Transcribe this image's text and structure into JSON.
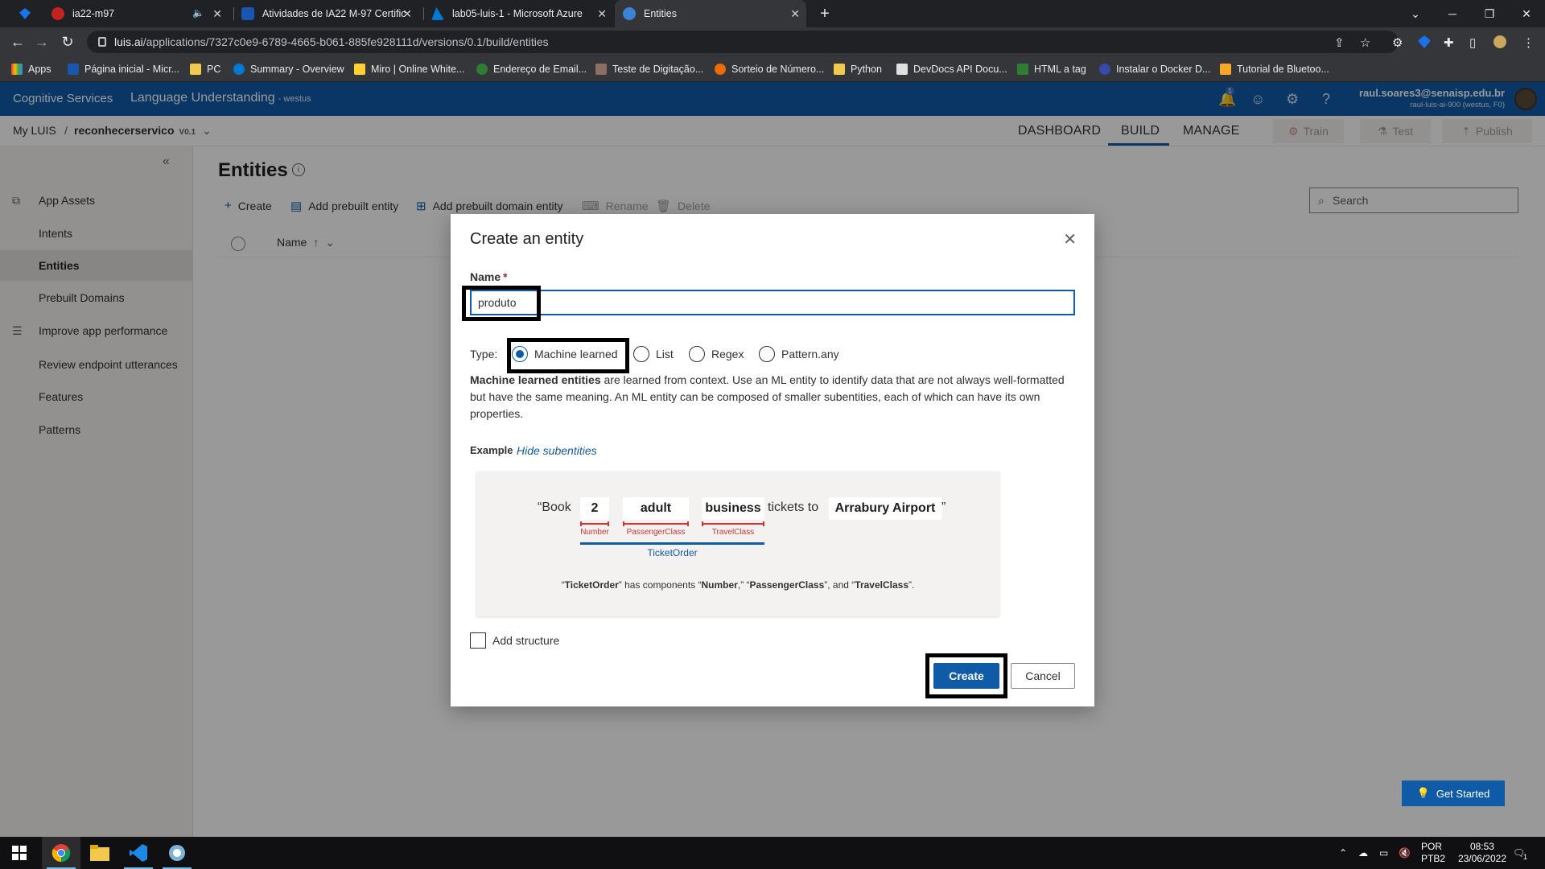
{
  "browser": {
    "tabs": [
      {
        "title": "ia22-m97",
        "active": false
      },
      {
        "title": "Atividades de IA22 M-97 Certific",
        "active": false
      },
      {
        "title": "lab05-luis-1 - Microsoft Azure",
        "active": false
      },
      {
        "title": "Entities",
        "active": true
      }
    ],
    "new_tab": "+",
    "url_host": "luis.ai",
    "url_path": "/applications/7327c0e9-6789-4665-b061-885fe928111d/versions/0.1/build/entities",
    "bookmarks": [
      "Apps",
      "Página inicial - Micr...",
      "PC",
      "Summary - Overview",
      "Miro | Online White...",
      "Endereço de Email...",
      "Teste de Digitação...",
      "Sorteio de Número...",
      "Python",
      "DevDocs API Docu...",
      "HTML a tag",
      "Instalar o Docker D...",
      "Tutorial de Bluetoo..."
    ]
  },
  "header": {
    "brand": "Cognitive Services",
    "product": "Language Understanding",
    "region": "- westus",
    "notification_count": "1",
    "user_email": "raul.soares3@senaisp.edu.br",
    "user_account": "raul-luis-ai-900 (westus, F0)"
  },
  "appbar": {
    "my_luis": "My LUIS",
    "separator": "/",
    "app_name": "reconhecerservico",
    "version": "V0.1",
    "tabs": [
      "DASHBOARD",
      "BUILD",
      "MANAGE"
    ],
    "active_tab": "BUILD",
    "train": "Train",
    "test": "Test",
    "publish": "Publish"
  },
  "sidebar": {
    "items": [
      {
        "label": "App Assets",
        "icon": "app-assets-icon"
      },
      {
        "label": "Intents"
      },
      {
        "label": "Entities",
        "active": true
      },
      {
        "label": "Prebuilt Domains"
      },
      {
        "label": "Improve app performance",
        "icon": "sliders-icon"
      },
      {
        "label": "Review endpoint utterances"
      },
      {
        "label": "Features"
      },
      {
        "label": "Patterns"
      }
    ]
  },
  "main": {
    "title": "Entities",
    "commands": {
      "create": "Create",
      "add_prebuilt": "Add prebuilt entity",
      "add_prebuilt_domain": "Add prebuilt domain entity",
      "rename": "Rename",
      "delete": "Delete"
    },
    "search_placeholder": "Search",
    "column_name": "Name",
    "get_started": "Get Started"
  },
  "dialog": {
    "title": "Create an entity",
    "name_label": "Name",
    "required_mark": "*",
    "name_value": "produto",
    "type_label": "Type:",
    "types": [
      "Machine learned",
      "List",
      "Regex",
      "Pattern.any"
    ],
    "selected_type": "Machine learned",
    "desc_bold": "Machine learned entities",
    "desc_rest": " are learned from context. Use an ML entity to identify data that are not always well-formatted but have the same meaning. An ML entity can be composed of smaller subentities, each of which can have its own properties.",
    "example_label": "Example",
    "hide_subentities": "Hide subentities",
    "example": {
      "quote_open": "“Book",
      "tokens": [
        "2",
        "adult",
        "business"
      ],
      "token_labels": [
        "Number",
        "PassengerClass",
        "TravelClass"
      ],
      "tickets_to": "tickets to",
      "destination": "Arrabury Airport",
      "quote_close": "”",
      "group_label": "TicketOrder",
      "caption_parts": [
        "“",
        "TicketOrder",
        "” has components “",
        "Number",
        ",” “",
        "PassengerClass",
        "”, and “",
        "TravelClass",
        "”."
      ]
    },
    "add_structure": "Add structure",
    "create_button": "Create",
    "cancel_button": "Cancel"
  },
  "taskbar": {
    "lang_line1": "POR",
    "lang_line2": "PTB2",
    "time": "08:53",
    "date": "23/06/2022",
    "notification_count": "1"
  },
  "colors": {
    "accent": "#0f5ba7",
    "entity_red": "#d13438",
    "browser_dark": "#202124"
  }
}
